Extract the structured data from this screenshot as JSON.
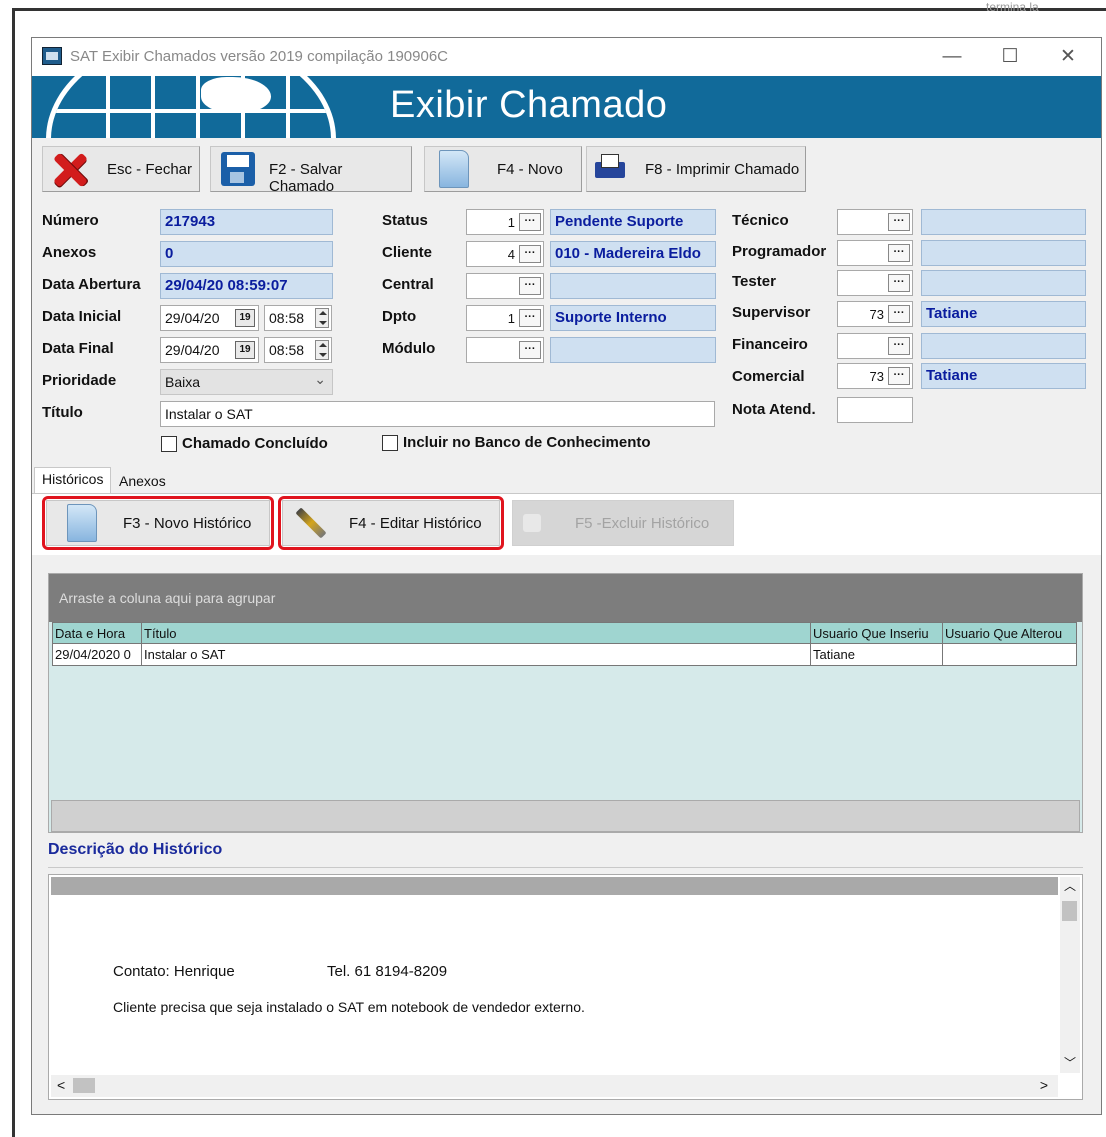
{
  "window": {
    "title": "SAT Exibir Chamados  versão 2019 compilação 190906C",
    "controls": {
      "minimize": "—",
      "maximize": "☐",
      "close": "✕"
    }
  },
  "banner": {
    "title": "Exibir Chamado"
  },
  "toolbar": {
    "close": "Esc - Fechar",
    "save": "F2 - Salvar Chamado",
    "new": "F4 - Novo",
    "print": "F8 - Imprimir Chamado"
  },
  "form": {
    "numero": {
      "label": "Número",
      "value": "217943"
    },
    "anexos": {
      "label": "Anexos",
      "value": "0"
    },
    "data_abertura": {
      "label": "Data Abertura",
      "value": "29/04/20 08:59:07"
    },
    "data_inicial": {
      "label": "Data Inicial",
      "date": "29/04/20",
      "time": "08:58"
    },
    "data_final": {
      "label": "Data Final",
      "date": "29/04/20",
      "time": "08:58"
    },
    "prioridade": {
      "label": "Prioridade",
      "value": "Baixa"
    },
    "titulo": {
      "label": "Título",
      "value": "Instalar o SAT"
    },
    "status": {
      "label": "Status",
      "code": "1",
      "value": "Pendente Suporte"
    },
    "cliente": {
      "label": "Cliente",
      "code": "4",
      "value": "010 - Madereira Eldo"
    },
    "central": {
      "label": "Central",
      "code": "",
      "value": ""
    },
    "dpto": {
      "label": "Dpto",
      "code": "1",
      "value": "Suporte Interno"
    },
    "modulo": {
      "label": "Módulo",
      "code": "",
      "value": ""
    },
    "tecnico": {
      "label": "Técnico",
      "code": "",
      "value": ""
    },
    "programador": {
      "label": "Programador",
      "code": "",
      "value": ""
    },
    "tester": {
      "label": "Tester",
      "code": "",
      "value": ""
    },
    "supervisor": {
      "label": "Supervisor",
      "code": "73",
      "value": "Tatiane"
    },
    "financeiro": {
      "label": "Financeiro",
      "code": "",
      "value": ""
    },
    "comercial": {
      "label": "Comercial",
      "code": "73",
      "value": "Tatiane"
    },
    "nota_atend": {
      "label": "Nota Atend.",
      "value": ""
    },
    "chamado_concluido": {
      "label": "Chamado Concluído",
      "checked": false
    },
    "incluir_banco": {
      "label": "Incluir no Banco de Conhecimento",
      "checked": false
    },
    "ellipsis": "···",
    "calendar_glyph": "19"
  },
  "tabs": [
    {
      "label": "Históricos"
    },
    {
      "label": "Anexos"
    }
  ],
  "history_buttons": {
    "new": "F3 - Novo Histórico",
    "edit": "F4 - Editar Histórico",
    "delete": "F5 -Excluir Histórico"
  },
  "grid": {
    "group_hint": "Arraste a coluna aqui para agrupar",
    "columns": [
      "Data e Hora",
      "Título",
      "Usuario Que Inseriu",
      "Usuario Que Alterou"
    ],
    "rows": [
      [
        "29/04/2020 0",
        "Instalar o SAT",
        "Tatiane",
        ""
      ]
    ]
  },
  "description": {
    "title": "Descrição do Histórico",
    "contact": "Contato: Henrique",
    "phone": "Tel. 61 8194-8209",
    "body": "Cliente precisa que seja instalado o SAT em notebook de vendedor externo."
  },
  "scroll_glyphs": {
    "up": "︿",
    "down": "﹀",
    "left": "<",
    "right": ">"
  },
  "colors": {
    "banner": "#116a9a",
    "field_bg": "#cfe0f1",
    "field_text": "#0a1d9e",
    "highlight": "#e0141e",
    "grid_header": "#9fd5d0",
    "grid_body": "#d6eaea",
    "description_title": "#1a2a9c"
  },
  "background_fragments": {
    "top_right": "termina la"
  }
}
